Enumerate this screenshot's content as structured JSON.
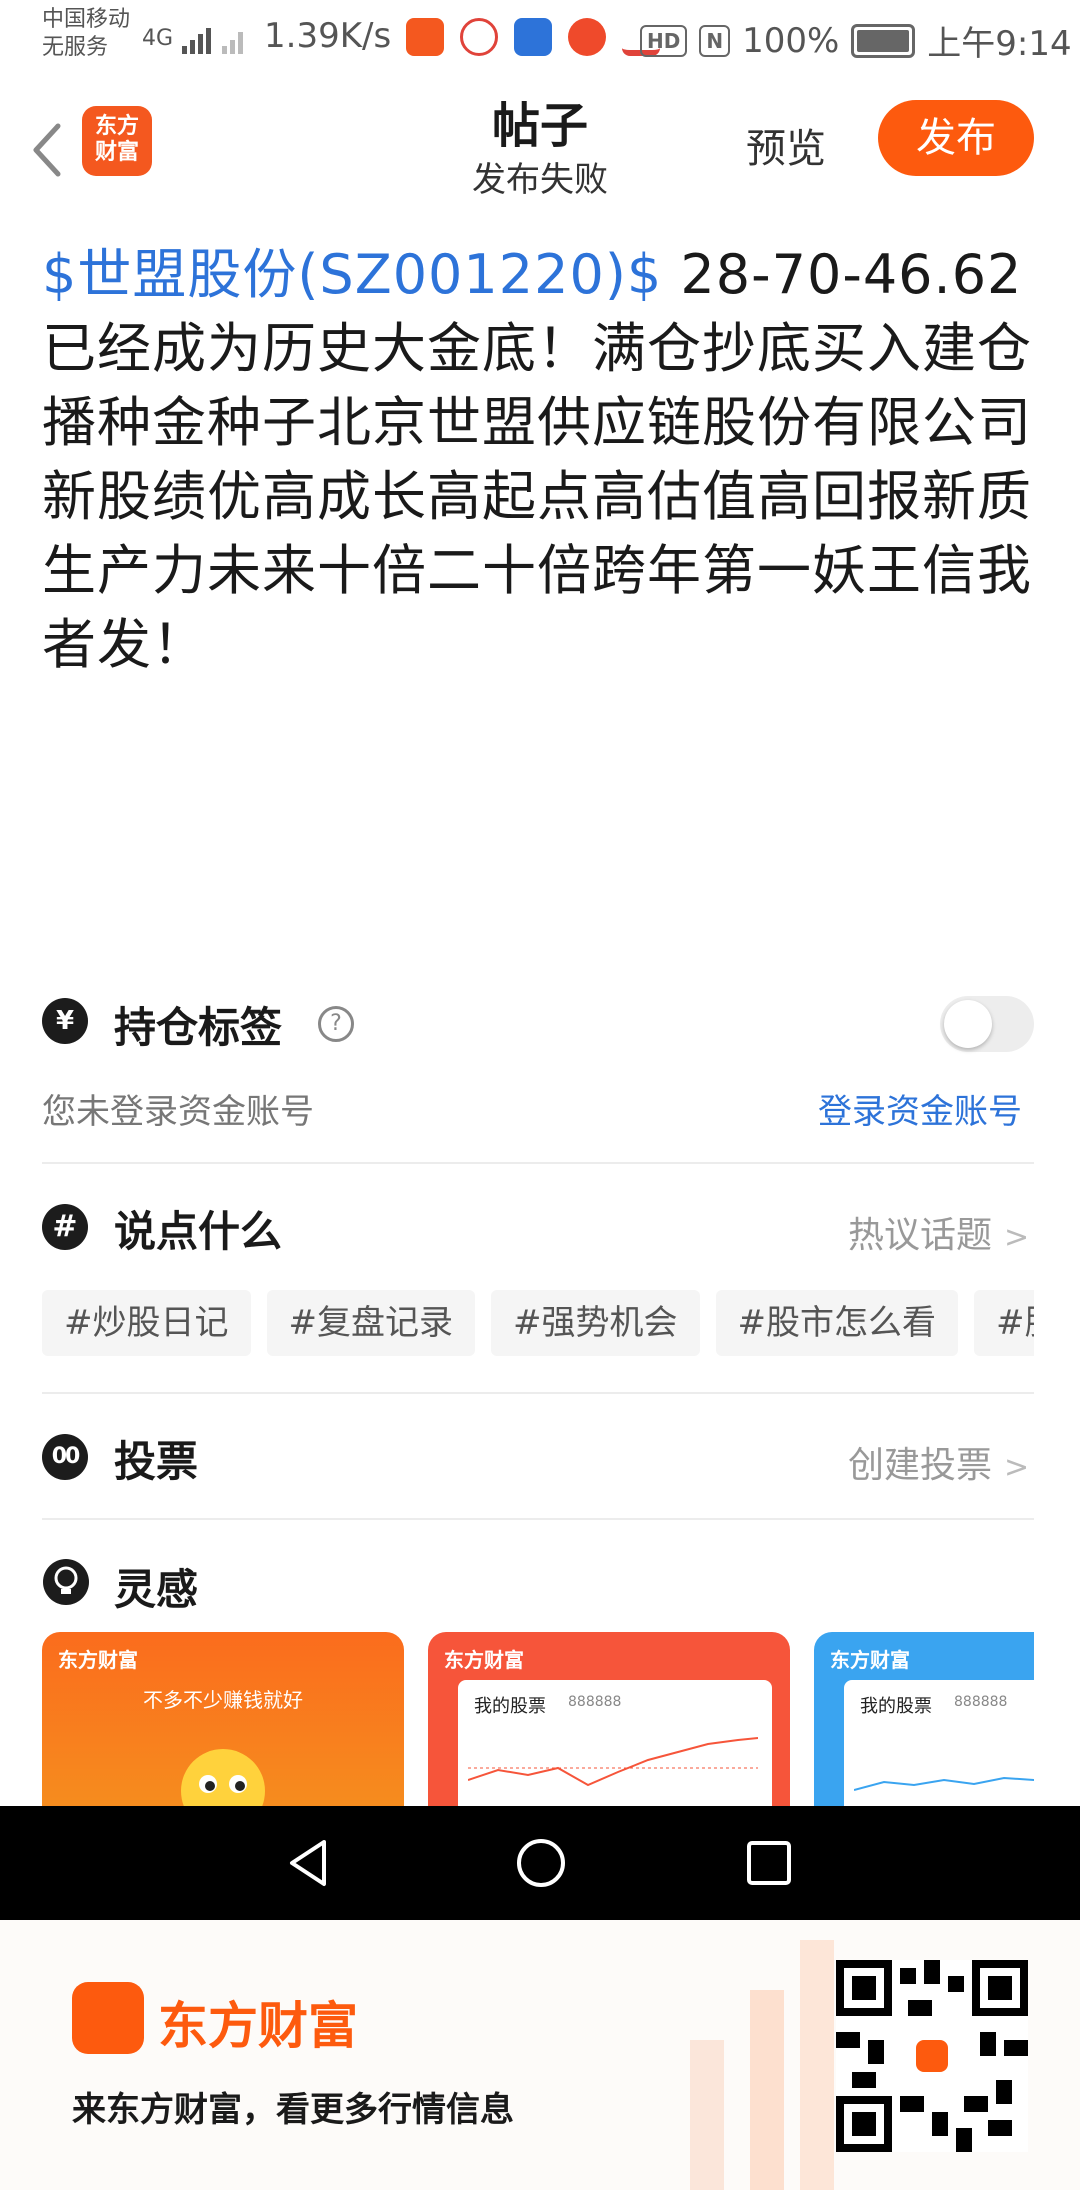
{
  "status_bar": {
    "carrier_line1": "中国移动",
    "carrier_line2": "无服务",
    "network": "4G",
    "speed": "1.39K/s",
    "hd": "HD",
    "nfc": "N",
    "battery": "100%",
    "time": "上午9:14",
    "app_colors": [
      "#f4581f",
      "#e0433a",
      "#2d73d9",
      "#ef4a2b",
      "#e0433a"
    ]
  },
  "header": {
    "logo_text": "东方\n财富",
    "title": "帖子",
    "subtitle": "发布失败",
    "preview_label": "预览",
    "publish_label": "发布"
  },
  "post": {
    "stock_tag": "$世盟股份(SZ001220)$",
    "body": " 28-70-46.62已经成为历史大金底！满仓抄底买入建仓播种金种子北京世盟供应链股份有限公司新股绩优高成长高起点高估值高回报新质生产力未来十倍二十倍跨年第一妖王信我者发！"
  },
  "holding": {
    "icon": "¥",
    "title": "持仓标签",
    "help": "?",
    "note": "您未登录资金账号",
    "login_link": "登录资金账号",
    "toggle_on": false
  },
  "topics": {
    "icon": "#",
    "title": "说点什么",
    "link": "热议话题",
    "tags": [
      "#炒股日记",
      "#复盘记录",
      "#强势机会",
      "#股市怎么看",
      "#股"
    ]
  },
  "vote": {
    "icon": "00",
    "title": "投票",
    "link": "创建投票"
  },
  "inspiration": {
    "title": "灵感",
    "cards": [
      {
        "brand": "东方财富",
        "caption": "不多不少赚钱就好",
        "color": "#fb6c1d"
      },
      {
        "brand": "东方财富",
        "panel_title": "我的股票",
        "panel_code": "888888",
        "color": "#f6553a"
      },
      {
        "brand": "东方财富",
        "panel_title": "我的股票",
        "panel_code": "888888",
        "color": "#3aa4f0"
      }
    ]
  },
  "banner": {
    "brand": "东方财富",
    "slogan": "来东方财富，看更多行情信息"
  }
}
